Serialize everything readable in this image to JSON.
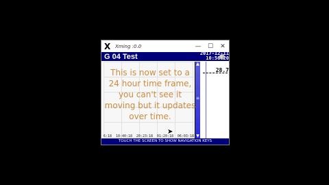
{
  "window": {
    "title": "Xming :0.0",
    "logo_glyph": "X",
    "minimize": "—",
    "maximize": "☐",
    "close": "✕"
  },
  "app": {
    "header_title": "G 04   Test",
    "date": "2017-12-11",
    "time": "10:56:20",
    "current_value": "28.7",
    "x_ticks": [
      "6:18",
      "10:40:18",
      "20:23:18",
      "01:20:18",
      "06:03:18"
    ],
    "footer_text": "TOUCH THE SCREEN TO SHOW NAVIGATION KEYS"
  },
  "overlay": {
    "text": "This is now set to a 24 hour time frame, you can't see it moving but it updates over time.",
    "color": "#cc8b3d"
  },
  "colors": {
    "header_bg": "#00007a",
    "scrollbar": "#2b2be0"
  }
}
